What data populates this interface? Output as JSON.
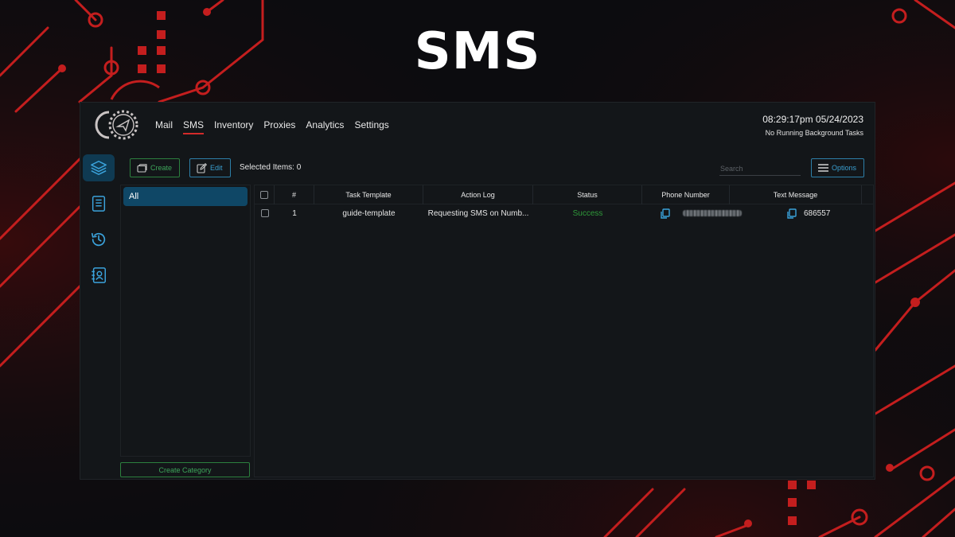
{
  "page": {
    "heading": "SMS"
  },
  "nav": {
    "items": [
      {
        "label": "Mail",
        "active": false
      },
      {
        "label": "SMS",
        "active": true
      },
      {
        "label": "Inventory",
        "active": false
      },
      {
        "label": "Proxies",
        "active": false
      },
      {
        "label": "Analytics",
        "active": false
      },
      {
        "label": "Settings",
        "active": false
      }
    ]
  },
  "status": {
    "time": "08:29:17pm 05/24/2023",
    "background_tasks": "No Running Background Tasks"
  },
  "sidebar": {
    "icons": [
      "layers-icon",
      "notebook-icon",
      "history-icon",
      "contacts-icon"
    ],
    "active_index": 0
  },
  "toolbar": {
    "create_label": "Create",
    "edit_label": "Edit",
    "selected_label": "Selected Items: 0",
    "search_placeholder": "Search",
    "options_label": "Options"
  },
  "categories": {
    "items": [
      "All"
    ],
    "create_label": "Create Category"
  },
  "table": {
    "columns": [
      "#",
      "Task Template",
      "Action Log",
      "Status",
      "Phone Number",
      "Text Message"
    ],
    "rows": [
      {
        "index": "1",
        "task_template": "guide-template",
        "action_log": "Requesting SMS on Numb...",
        "status": "Success",
        "phone_number": "",
        "text_message": "686557"
      }
    ]
  },
  "colors": {
    "accent_red": "#d32a2a",
    "create_green": "#3ea55a",
    "edit_blue": "#3a9fd0",
    "active_category": "#0f4766",
    "success": "#2f9a3a"
  }
}
